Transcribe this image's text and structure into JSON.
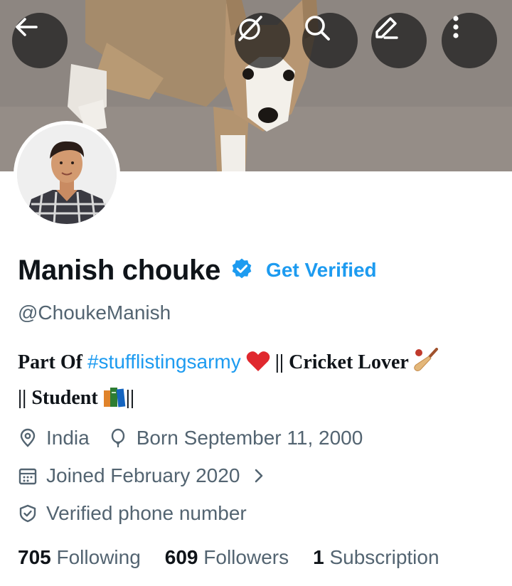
{
  "header": {
    "buttons": [
      {
        "name": "back-button",
        "icon": "back-arrow-icon"
      },
      {
        "name": "grok-button",
        "icon": "grok-icon"
      },
      {
        "name": "search-button",
        "icon": "search-icon"
      },
      {
        "name": "edit-profile-button",
        "icon": "edit-pencil-icon"
      },
      {
        "name": "more-options-button",
        "icon": "more-vertical-icon"
      }
    ]
  },
  "profile": {
    "name": "Manish chouke",
    "get_verified_label": "Get Verified",
    "handle": "@ChoukeManish",
    "bio": {
      "prefix": "Part Of ",
      "hashtag": "#stufflistingsarmy",
      "middle": " || Cricket Lover ",
      "line2": "|| Student ",
      "suffix": "||"
    },
    "location": "India",
    "birthday": "Born September 11, 2000",
    "joined": "Joined February 2020",
    "verified_phone": "Verified phone number"
  },
  "stats": {
    "following_count": "705",
    "following_label": "Following",
    "followers_count": "609",
    "followers_label": "Followers",
    "subscriptions_count": "1",
    "subscriptions_label": "Subscription"
  },
  "colors": {
    "accent": "#1d9bf0",
    "secondary_text": "#536471",
    "primary_text": "#0f1419"
  }
}
